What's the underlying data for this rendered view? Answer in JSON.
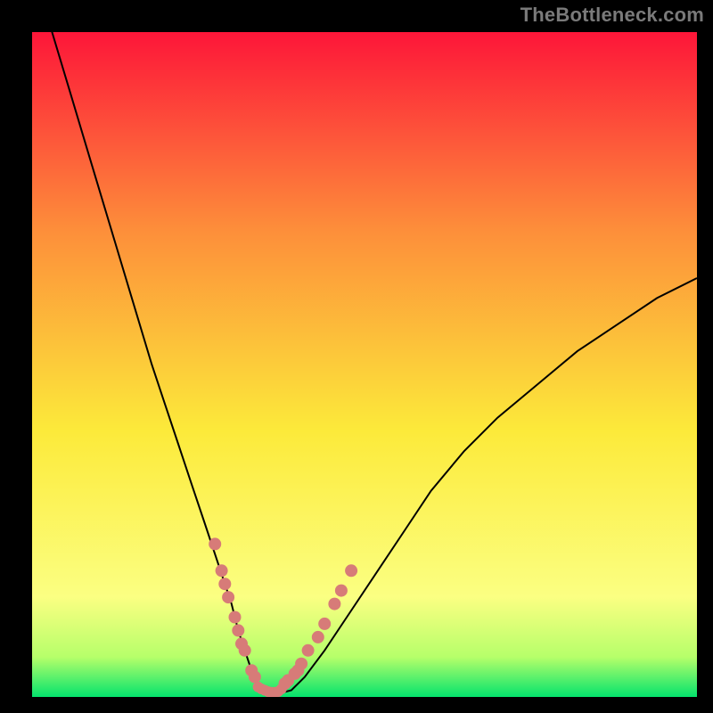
{
  "header": {
    "watermark": "TheBottleneck.com"
  },
  "chart_data": {
    "type": "line",
    "title": "",
    "xlabel": "",
    "ylabel": "",
    "xlim": [
      0,
      100
    ],
    "ylim": [
      0,
      100
    ],
    "grid": false,
    "legend": false,
    "background_gradient": {
      "top": "#fd1639",
      "mid_upper": "#fd8f3a",
      "mid": "#fcea3a",
      "mid_lower": "#fbff82",
      "near_bottom": "#b6ff6a",
      "bottom": "#04e36d"
    },
    "series": [
      {
        "name": "bottleneck_curve",
        "x": [
          0,
          3,
          6,
          9,
          12,
          15,
          18,
          20,
          22,
          24,
          26,
          28,
          30,
          31,
          32,
          33,
          34,
          35,
          36,
          37,
          39,
          41,
          44,
          48,
          52,
          56,
          60,
          65,
          70,
          76,
          82,
          88,
          94,
          100
        ],
        "y": [
          110,
          100,
          90,
          80,
          70,
          60,
          50,
          44,
          38,
          32,
          26,
          20,
          14,
          10,
          7,
          4,
          2,
          1,
          0.5,
          0.5,
          1,
          3,
          7,
          13,
          19,
          25,
          31,
          37,
          42,
          47,
          52,
          56,
          60,
          63
        ]
      }
    ],
    "marker_points": {
      "comment": "Salmon dots near the trough on both branches",
      "left_branch_x": [
        27.5,
        28.5,
        29.0,
        29.5,
        30.5,
        31.0,
        31.5,
        32.0,
        33.0,
        33.5
      ],
      "left_branch_y": [
        23,
        19,
        17,
        15,
        12,
        10,
        8,
        7,
        4,
        3
      ],
      "right_branch_x": [
        38.0,
        38.5,
        39.5,
        40.0,
        40.5,
        41.5,
        43.0,
        44.0,
        45.5,
        46.5,
        48.0
      ],
      "right_branch_y": [
        2,
        2.5,
        3.5,
        4,
        5,
        7,
        9,
        11,
        14,
        16,
        19
      ],
      "trough_x": [
        34.0,
        34.5,
        35.0,
        35.5,
        36.0,
        36.5,
        37.0,
        37.5
      ],
      "trough_y": [
        1.5,
        1.2,
        1.0,
        0.8,
        0.7,
        0.7,
        0.8,
        1.2
      ]
    },
    "colors": {
      "curve": "#000000",
      "markers": "#d77b78"
    }
  }
}
